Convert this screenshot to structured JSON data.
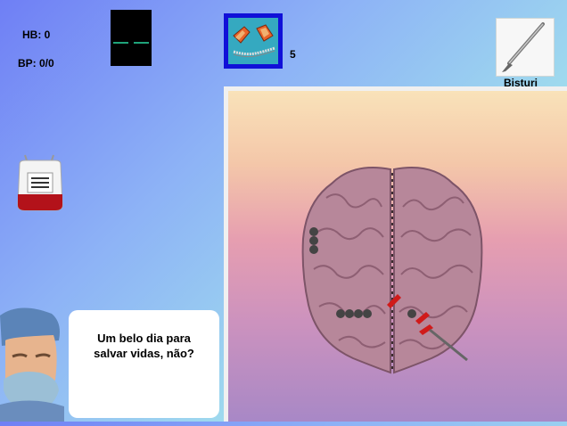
{
  "vitals": {
    "hb_label": "HB: 0",
    "bp_label": "BP: 0/0"
  },
  "tool": {
    "count": "5"
  },
  "current_tool": {
    "label": "Bisturi"
  },
  "dialog": {
    "line1": "Um belo dia para",
    "line2": "salvar vidas, não?"
  }
}
